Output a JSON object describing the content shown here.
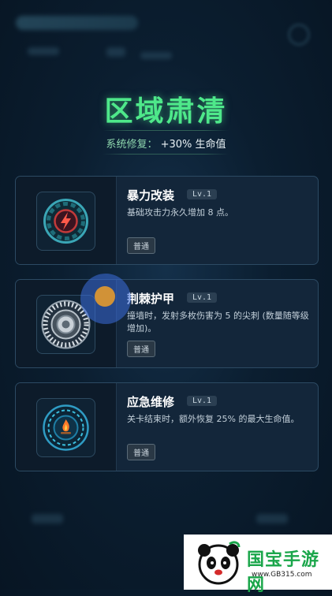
{
  "header": {
    "title": "区域肃清",
    "subtitle_label": "系统修复：",
    "subtitle_value": "+30%  生命值"
  },
  "cards": [
    {
      "name": "暴力改装",
      "level": "Lv.1",
      "description": "基础攻击力永久增加 8 点。",
      "rarity": "普通",
      "icon": "lightning-shield-icon"
    },
    {
      "name": "荆棘护甲",
      "level": "Lv.1",
      "description": "撞墙时，发射多枚伤害为 5 的尖刺 (数量随等级增加)。",
      "rarity": "普通",
      "icon": "spiked-wheel-icon"
    },
    {
      "name": "应急维修",
      "level": "Lv.1",
      "description": "关卡结束时，额外恢复 25% 的最大生命值。",
      "rarity": "普通",
      "icon": "campfire-ring-icon"
    }
  ],
  "watermark": {
    "brand": "国宝手游网",
    "domain": "www.GB315.com"
  },
  "colors": {
    "title_green": "#4ee88a",
    "card_bg": "#13263a",
    "card_border": "#2c4a63",
    "background": "#0b1e30"
  }
}
